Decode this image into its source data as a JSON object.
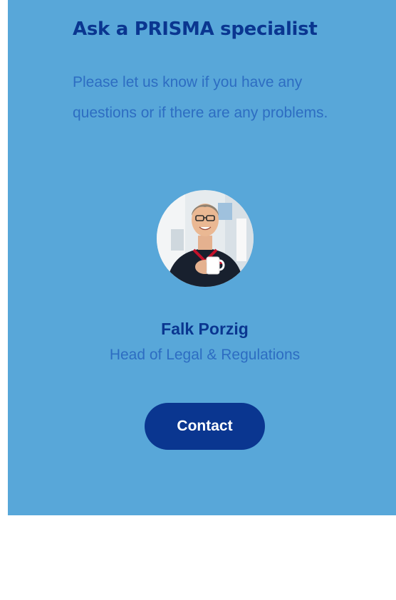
{
  "specialist_box": {
    "title": "Ask a PRISMA specialist",
    "intro": "Please let us know if you have any questions or if there are any problems.",
    "person": {
      "name": "Falk Porzig",
      "role": "Head of Legal & Regulations"
    },
    "contact_label": "Contact"
  },
  "colors": {
    "card_background": "#58a7d9",
    "heading": "#0a3690",
    "body_text": "#2d6dc2",
    "button": "#0a3690",
    "button_text": "#ffffff"
  }
}
